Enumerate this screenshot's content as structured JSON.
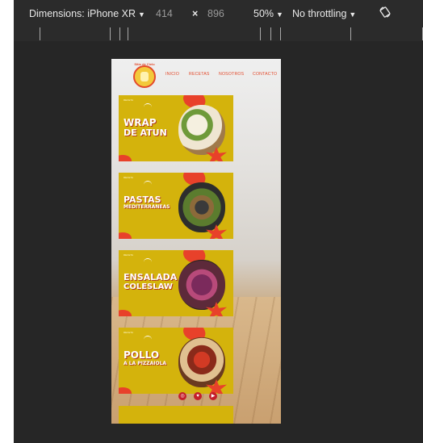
{
  "devtools": {
    "device_label": "Dimensions: iPhone XR",
    "width": "414",
    "times": "×",
    "height": "896",
    "zoom": "50%",
    "throttle": "No throttling",
    "rotate_icon": "rotate-icon"
  },
  "site": {
    "logo_text": "Sitio de Cielo",
    "nav": [
      "INICIO",
      "RECETAS",
      "NOSOTROS",
      "CONTACTO"
    ],
    "cards": [
      {
        "tag": "RECETA",
        "line1": "WRAP",
        "line2": "DE ATUN"
      },
      {
        "tag": "RECETA",
        "line1": "PASTAS",
        "line2": "MEDITERRANEAS"
      },
      {
        "tag": "RECETA",
        "line1": "ENSALADA",
        "line2": "COLESLAW"
      },
      {
        "tag": "RECETA",
        "line1": "POLLO",
        "line2": "A LA PIZZAIOLA"
      }
    ],
    "socials": [
      "instagram-icon",
      "twitter-icon",
      "youtube-icon"
    ]
  },
  "colors": {
    "card_yellow": "#d4b30c",
    "accent_red": "#e34a2c",
    "devtools_bg": "#262626"
  }
}
